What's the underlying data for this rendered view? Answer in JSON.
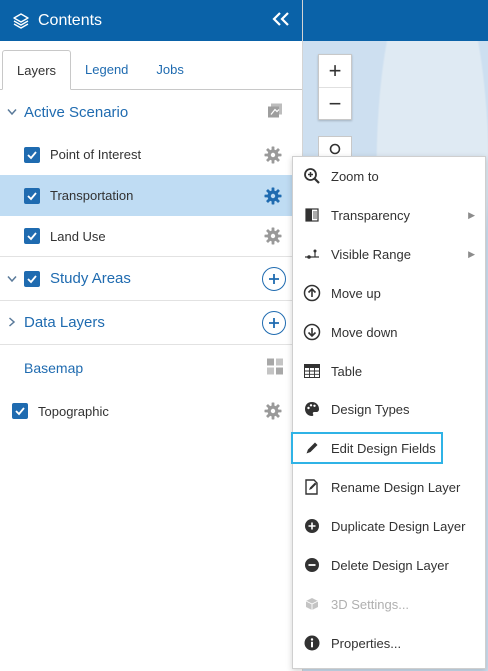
{
  "header": {
    "title": "Contents",
    "collapse_label": "«"
  },
  "tabs": [
    {
      "label": "Layers",
      "active": true
    },
    {
      "label": "Legend",
      "active": false
    },
    {
      "label": "Jobs",
      "active": false
    }
  ],
  "active_scenario": {
    "title": "Active Scenario",
    "layers": [
      {
        "label": "Point of Interest",
        "checked": true,
        "selected": false
      },
      {
        "label": "Transportation",
        "checked": true,
        "selected": true
      },
      {
        "label": "Land Use",
        "checked": true,
        "selected": false
      }
    ]
  },
  "study_areas": {
    "title": "Study Areas",
    "checked": true
  },
  "data_layers": {
    "title": "Data Layers"
  },
  "basemap": {
    "title": "Basemap",
    "layer_label": "Topographic",
    "checked": true
  },
  "map": {
    "zoom_in": "+",
    "zoom_out": "−"
  },
  "context_menu": {
    "items": [
      {
        "label": "Zoom to",
        "icon": "zoom-to-icon"
      },
      {
        "label": "Transparency",
        "icon": "transparency-icon",
        "submenu": true
      },
      {
        "label": "Visible Range",
        "icon": "visible-range-icon",
        "submenu": true
      },
      {
        "label": "Move up",
        "icon": "move-up-icon"
      },
      {
        "label": "Move down",
        "icon": "move-down-icon"
      },
      {
        "label": "Table",
        "icon": "table-icon"
      },
      {
        "label": "Design Types",
        "icon": "palette-icon"
      },
      {
        "label": "Edit Design Fields",
        "icon": "pencil-icon",
        "highlighted": true
      },
      {
        "label": "Rename Design Layer",
        "icon": "rename-icon"
      },
      {
        "label": "Duplicate Design Layer",
        "icon": "duplicate-icon"
      },
      {
        "label": "Delete Design Layer",
        "icon": "delete-icon"
      },
      {
        "label": "3D Settings...",
        "icon": "3d-cube-icon",
        "disabled": true
      },
      {
        "label": "Properties...",
        "icon": "info-icon"
      }
    ]
  },
  "colors": {
    "brand": "#0a62a8",
    "link": "#1f6bb0",
    "selected_row": "#bfdcf3",
    "highlight_border": "#2fb3e6"
  }
}
